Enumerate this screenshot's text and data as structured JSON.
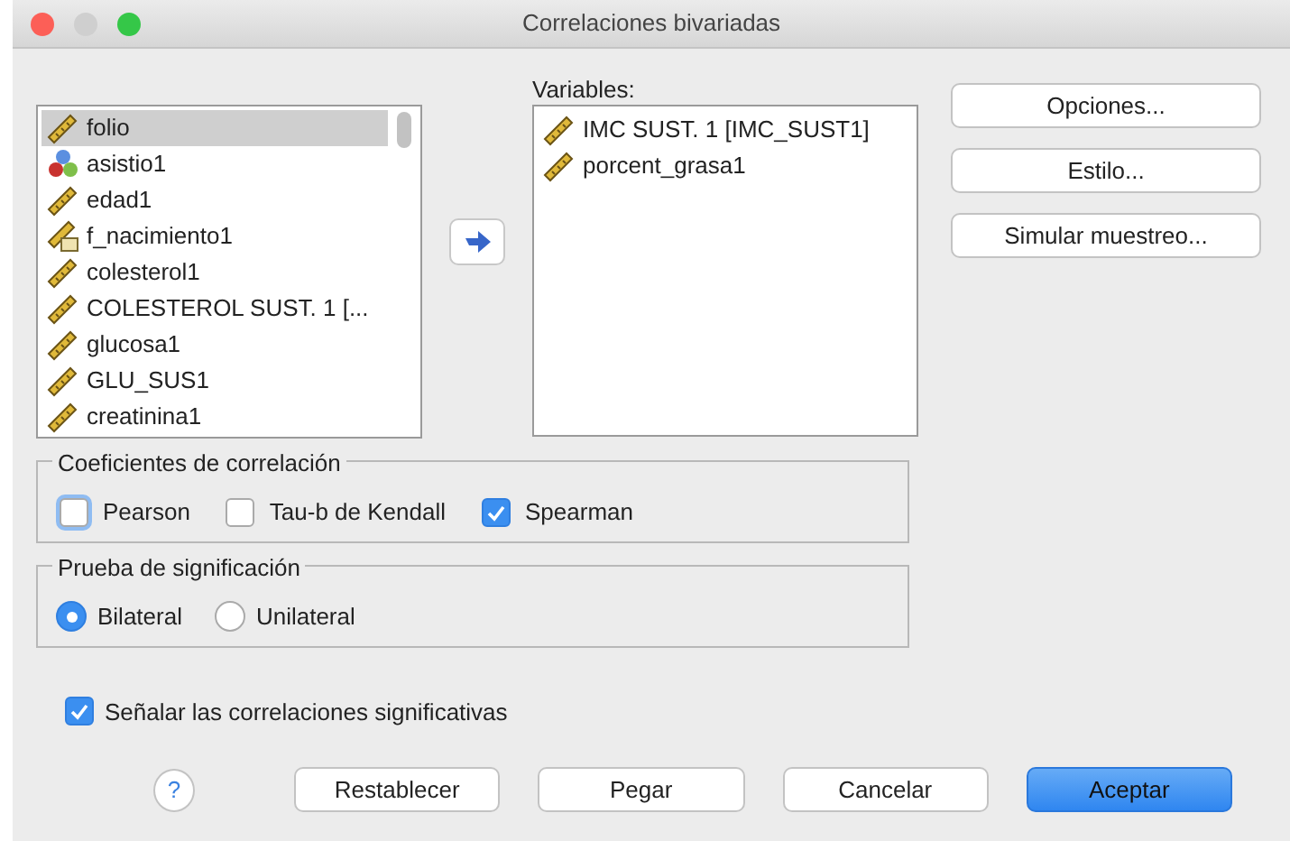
{
  "window": {
    "title": "Correlaciones bivariadas"
  },
  "source_list": {
    "items": [
      {
        "label": "folio",
        "kind": "scale",
        "selected": true
      },
      {
        "label": "asistio1",
        "kind": "nominal",
        "selected": false
      },
      {
        "label": "edad1",
        "kind": "scale",
        "selected": false
      },
      {
        "label": "f_nacimiento1",
        "kind": "date",
        "selected": false
      },
      {
        "label": "colesterol1",
        "kind": "scale",
        "selected": false
      },
      {
        "label": "COLESTEROL SUST. 1 [...",
        "kind": "scale",
        "selected": false
      },
      {
        "label": "glucosa1",
        "kind": "scale",
        "selected": false
      },
      {
        "label": "GLU_SUS1",
        "kind": "scale",
        "selected": false
      },
      {
        "label": "creatinina1",
        "kind": "scale",
        "selected": false
      }
    ]
  },
  "variables": {
    "label": "Variables:",
    "items": [
      {
        "label": "IMC SUST. 1 [IMC_SUST1]",
        "kind": "scale",
        "selected": false
      },
      {
        "label": "porcent_grasa1",
        "kind": "scale",
        "selected": false
      }
    ]
  },
  "side_buttons": [
    "Opciones...",
    "Estilo...",
    "Simular muestreo..."
  ],
  "coefficients": {
    "title": "Coeficientes de correlación",
    "options": [
      {
        "label": "Pearson",
        "checked": false,
        "focused": true
      },
      {
        "label": "Tau-b de Kendall",
        "checked": false,
        "focused": false
      },
      {
        "label": "Spearman",
        "checked": true,
        "focused": false
      }
    ]
  },
  "significance": {
    "title": "Prueba de significación",
    "options": [
      {
        "label": "Bilateral",
        "selected": true
      },
      {
        "label": "Unilateral",
        "selected": false
      }
    ]
  },
  "flag_significant": {
    "label": "Señalar las correlaciones significativas",
    "checked": true
  },
  "help": {
    "label": "?"
  },
  "buttons": [
    {
      "label": "Restablecer",
      "default": false
    },
    {
      "label": "Pegar",
      "default": false
    },
    {
      "label": "Cancelar",
      "default": false
    },
    {
      "label": "Aceptar",
      "default": true
    }
  ]
}
